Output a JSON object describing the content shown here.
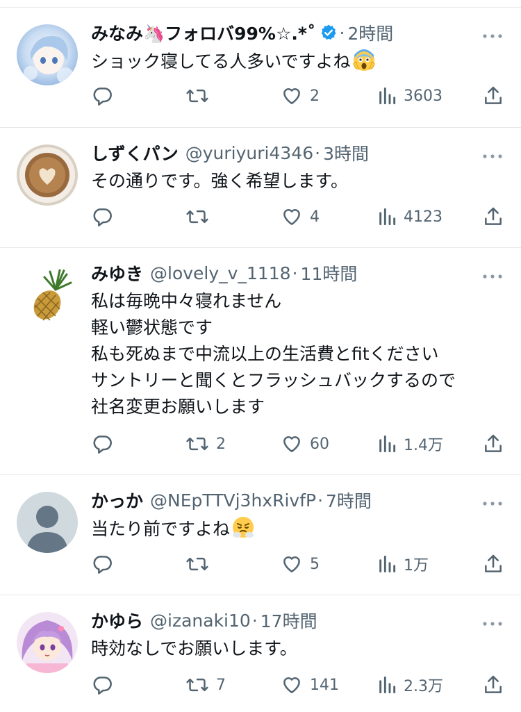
{
  "tweets": [
    {
      "display_name": "みなみ🦄フォロバ99%☆.*˚",
      "handle": "",
      "verified": true,
      "time": "2時間",
      "lines": [
        "ショック寝してる人多いですよね"
      ],
      "replies": "",
      "retweets": "",
      "likes": "2",
      "views": "3603",
      "avatar": "anime-girl-blue"
    },
    {
      "display_name": "しずくパン",
      "handle": "@yuriyuri4346",
      "verified": false,
      "time": "3時間",
      "lines": [
        "その通りです。強く希望します。"
      ],
      "replies": "",
      "retweets": "",
      "likes": "4",
      "views": "4123",
      "avatar": "latte-art"
    },
    {
      "display_name": "みゆき",
      "handle": "@lovely_v_1118",
      "verified": false,
      "time": "11時間",
      "lines": [
        "私は毎晩中々寝れません",
        "軽い鬱状態です",
        "私も死ぬまで中流以上の生活費とfitください",
        "サントリーと聞くとフラッシュバックするので",
        "社名変更お願いします"
      ],
      "replies": "",
      "retweets": "2",
      "likes": "60",
      "views": "1.4万",
      "avatar": "pineapple"
    },
    {
      "display_name": "かっか",
      "handle": "@NEpTTVj3hxRivfP",
      "verified": false,
      "time": "7時間",
      "lines": [
        "当たり前ですよね"
      ],
      "replies": "",
      "retweets": "",
      "likes": "5",
      "views": "1万",
      "avatar": "default-person"
    },
    {
      "display_name": "かゆら",
      "handle": "@izanaki10",
      "verified": false,
      "time": "17時間",
      "lines": [
        "時効なしでお願いします。"
      ],
      "replies": "",
      "retweets": "7",
      "likes": "141",
      "views": "2.3万",
      "avatar": "anime-girl-purple"
    }
  ],
  "time_separator": "·",
  "colors": {
    "text": "#0f1419",
    "secondary": "#536471",
    "verified": "#1d9bf0",
    "divider": "#e6e9ec"
  }
}
